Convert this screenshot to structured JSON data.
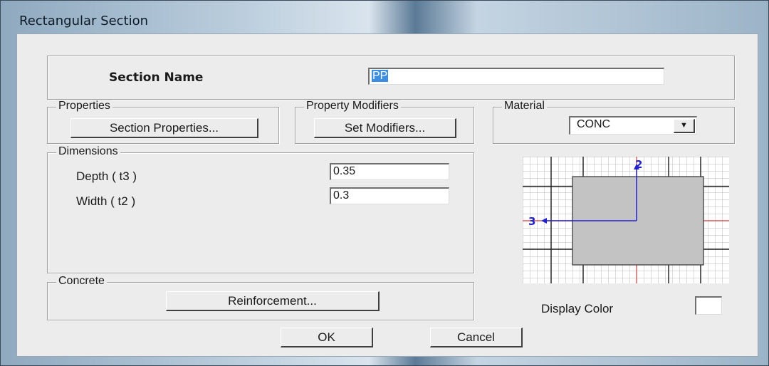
{
  "window": {
    "title": "Rectangular Section"
  },
  "section_name": {
    "label": "Section Name",
    "value": "PP"
  },
  "properties": {
    "group_label": "Properties",
    "button_label": "Section Properties..."
  },
  "modifiers": {
    "group_label": "Property Modifiers",
    "button_label": "Set Modifiers..."
  },
  "material": {
    "group_label": "Material",
    "selected": "CONC"
  },
  "dimensions": {
    "group_label": "Dimensions",
    "depth_label": "Depth  ( t3 )",
    "depth_value": "0.35",
    "width_label": "Width  ( t2 )",
    "width_value": "0.3"
  },
  "concrete": {
    "group_label": "Concrete",
    "button_label": "Reinforcement..."
  },
  "preview": {
    "axis_2_label": "2",
    "axis_3_label": "3"
  },
  "display_color": {
    "label": "Display Color",
    "color": "#ffffff"
  },
  "footer": {
    "ok_label": "OK",
    "cancel_label": "Cancel"
  }
}
